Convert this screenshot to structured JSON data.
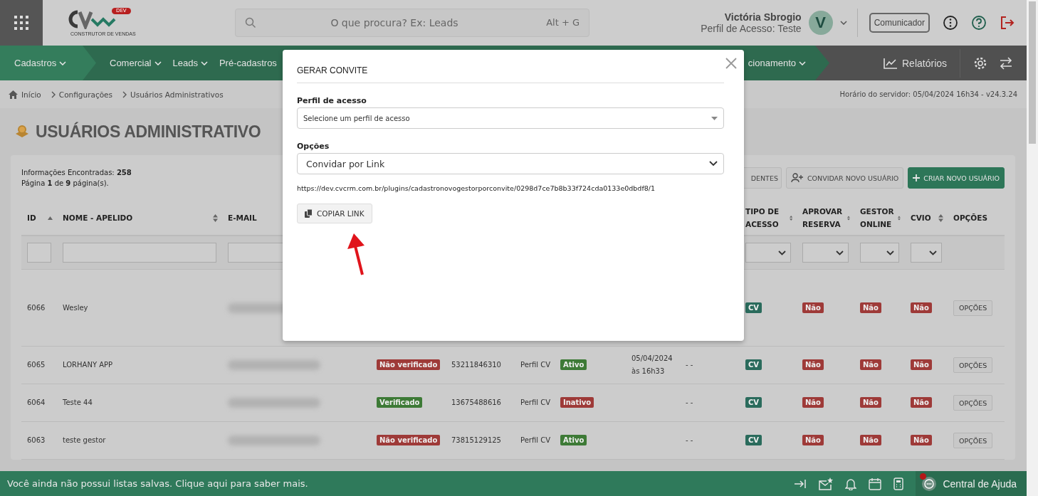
{
  "header": {
    "logo_badge": "DEV",
    "logo_tagline": "CONSTRUTOR DE VENDAS",
    "search": {
      "placeholder": "O que procura? Ex: Leads",
      "shortcut": "Alt + G"
    },
    "user": {
      "name": "Victória Sbrogio",
      "profile": "Perfil de Acesso: Teste",
      "initial": "V"
    },
    "communicator_button": "Comunicador"
  },
  "nav": {
    "items": [
      {
        "label": "Cadastros",
        "selected": true
      },
      {
        "label": "Comercial",
        "selected": false
      },
      {
        "label": "Leads",
        "selected": false
      },
      {
        "label": "Pré-cadastros",
        "selected": false
      }
    ],
    "right_item": "cionamento",
    "reports": "Relatórios"
  },
  "breadcrumb": [
    "Início",
    "Configurações",
    "Usuários Administrativos"
  ],
  "server_time": "Horário do servidor: 05/04/2024 16h34 - v24.3.24",
  "page_title": "USUÁRIOS ADMINISTRATIVO",
  "summary": {
    "found": "Informações Encontradas: **258**",
    "pages": "Página **1** de **9** página(s)."
  },
  "actions": [
    {
      "label": "DENTES",
      "kind": "partial"
    },
    {
      "label": "CONVIDAR NOVO USUÁRIO",
      "kind": "invite"
    },
    {
      "label": "CRIAR NOVO USUÁRIO",
      "kind": "create"
    }
  ],
  "table": {
    "columns": [
      {
        "label": "ID",
        "sort": {
          "kind": "asc"
        },
        "filter": {
          "kind": "text"
        }
      },
      {
        "label": "NOME - APELIDO",
        "sort": {
          "kind": "both"
        },
        "filter": {
          "kind": "text"
        }
      },
      {
        "label": "E-MAIL",
        "filter": {
          "kind": "text"
        }
      },
      {},
      {},
      {},
      {},
      {},
      {},
      {
        "label": "TIPO DE ACESSO",
        "sort": {
          "kind": "both"
        },
        "filter": {
          "kind": "select"
        }
      },
      {
        "label": "APROVAR RESERVA",
        "sort": {
          "kind": "both"
        },
        "filter": {
          "kind": "select"
        }
      },
      {
        "label": "GESTOR ONLINE",
        "sort": {
          "kind": "both"
        },
        "filter": {
          "kind": "select"
        }
      },
      {
        "label": "CVIO",
        "sort": {
          "kind": "both"
        },
        "filter": {
          "kind": "select"
        }
      },
      {
        "label": "OPÇÕES"
      }
    ],
    "rows": [
      {
        "tall": true,
        "cells": [
          {
            "kind": "text",
            "text": "6066"
          },
          {
            "kind": "text",
            "text": "Wesley"
          },
          {
            "kind": "blurred"
          },
          null,
          null,
          null,
          null,
          null,
          null,
          {
            "kind": "badge",
            "text": "CV",
            "color": "#2a6b5c"
          },
          {
            "kind": "badge",
            "text": "Não",
            "color": "#9e3a38"
          },
          {
            "kind": "badge",
            "text": "Não",
            "color": "#9e3a38"
          },
          {
            "kind": "badge",
            "text": "Não",
            "color": "#9e3a38"
          },
          {
            "kind": "button",
            "text": "OPÇÕES"
          }
        ]
      },
      {
        "tall": false,
        "cells": [
          {
            "kind": "text",
            "text": "6065"
          },
          {
            "kind": "text",
            "text": "LORHANY APP"
          },
          {
            "kind": "blurred"
          },
          {
            "kind": "badge",
            "text": "Não verificado",
            "color": "#9e3a38"
          },
          {
            "kind": "text",
            "text": "53211846310"
          },
          {
            "kind": "text",
            "text": "Perfil CV"
          },
          {
            "kind": "badge",
            "text": "Ativo",
            "color": "#3d7a36"
          },
          {
            "kind": "text",
            "text": "05/04/2024 às 16h33"
          },
          {
            "kind": "text",
            "text": "- -"
          },
          {
            "kind": "badge",
            "text": "CV",
            "color": "#2a6b5c"
          },
          {
            "kind": "badge",
            "text": "Não",
            "color": "#9e3a38"
          },
          {
            "kind": "badge",
            "text": "Não",
            "color": "#9e3a38"
          },
          {
            "kind": "badge",
            "text": "Não",
            "color": "#9e3a38"
          },
          {
            "kind": "button",
            "text": "OPÇÕES"
          }
        ]
      },
      {
        "tall": false,
        "cells": [
          {
            "kind": "text",
            "text": "6064"
          },
          {
            "kind": "text",
            "text": "Teste 44"
          },
          {
            "kind": "blurred"
          },
          {
            "kind": "badge",
            "text": "Verificado",
            "color": "#3d7a36"
          },
          {
            "kind": "text",
            "text": "13675488616"
          },
          {
            "kind": "text",
            "text": "Perfil CV"
          },
          {
            "kind": "badge",
            "text": "Inativo",
            "color": "#9e3a38"
          },
          null,
          {
            "kind": "text",
            "text": "- -"
          },
          {
            "kind": "badge",
            "text": "CV",
            "color": "#2a6b5c"
          },
          {
            "kind": "badge",
            "text": "Não",
            "color": "#9e3a38"
          },
          {
            "kind": "badge",
            "text": "Não",
            "color": "#9e3a38"
          },
          {
            "kind": "badge",
            "text": "Não",
            "color": "#9e3a38"
          },
          {
            "kind": "button",
            "text": "OPÇÕES"
          }
        ]
      },
      {
        "tall": false,
        "cells": [
          {
            "kind": "text",
            "text": "6063"
          },
          {
            "kind": "text",
            "text": "teste gestor"
          },
          {
            "kind": "blurred"
          },
          {
            "kind": "badge",
            "text": "Não verificado",
            "color": "#9e3a38"
          },
          {
            "kind": "text",
            "text": "73815129125"
          },
          {
            "kind": "text",
            "text": "Perfil CV"
          },
          {
            "kind": "badge",
            "text": "Ativo",
            "color": "#3d7a36"
          },
          null,
          {
            "kind": "text",
            "text": "- -"
          },
          {
            "kind": "badge",
            "text": "CV",
            "color": "#2a6b5c"
          },
          {
            "kind": "badge",
            "text": "Não",
            "color": "#9e3a38"
          },
          {
            "kind": "badge",
            "text": "Não",
            "color": "#9e3a38"
          },
          {
            "kind": "badge",
            "text": "Não",
            "color": "#9e3a38"
          },
          {
            "kind": "button",
            "text": "OPÇÕES"
          }
        ]
      }
    ]
  },
  "status_bar": {
    "message": "Você ainda não possui listas salvas. Clique aqui para saber mais.",
    "help": "Central de Ajuda",
    "help_notification": true
  },
  "modal": {
    "title": "GERAR CONVITE",
    "profile_label": "Perfil de acesso",
    "profile_placeholder": "Selecione um perfil de acesso",
    "options_label": "Opções",
    "options_value": "Convidar por Link",
    "link": "https://dev.cvcrm.com.br/plugins/cadastronovogestorporconvite/0298d7ce7b8b33f724cda0133e0dbdf8/1",
    "copy_button": "COPIAR LINK"
  }
}
